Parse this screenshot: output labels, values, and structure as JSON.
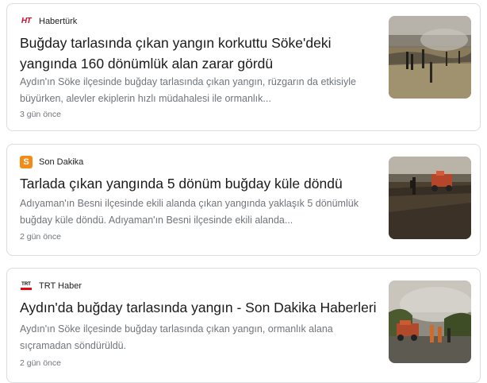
{
  "articles": [
    {
      "source": "Habertürk",
      "logo_text": "HT",
      "title": "Buğday tarlasında çıkan yangın korkuttu Söke'deki yangında 160 dönümlük alan zarar gördü",
      "snippet": "Aydın'ın Söke ilçesinde buğday tarlasında çıkan yangın, rüzgarın da etkisiyle büyürken, alevler ekiplerin hızlı müdahalesi ile ormanlık...",
      "time": "3 gün önce"
    },
    {
      "source": "Son Dakika",
      "logo_text": "S",
      "title": "Tarlada çıkan yangında 5 dönüm buğday küle döndü",
      "snippet": "Adıyaman'ın Besni ilçesinde ekili alanda çıkan yangında yaklaşık 5 dönümlük buğday küle döndü. Adıyaman'ın Besni ilçesinde ekili alanda...",
      "time": "2 gün önce"
    },
    {
      "source": "TRT Haber",
      "logo_text": "TRT",
      "title": "Aydın'da buğday tarlasında yangın - Son Dakika Haberleri",
      "snippet": "Aydın'ın Söke ilçesinde buğday tarlasında çıkan yangın, ormanlık alana sıçramadan söndürüldü.",
      "time": "2 gün önce"
    }
  ],
  "colors": {
    "card_border": "#dadce0",
    "title": "#1a1a1a",
    "meta_text": "#70757a",
    "habertürk_red": "#c8102e",
    "sondakika_orange": "#f28c18",
    "trt_red": "#e30a17"
  },
  "icons": {
    "article_1_logo": "haberturk-logo-icon",
    "article_2_logo": "sondakika-logo-icon",
    "article_3_logo": "trt-haber-logo-icon"
  }
}
